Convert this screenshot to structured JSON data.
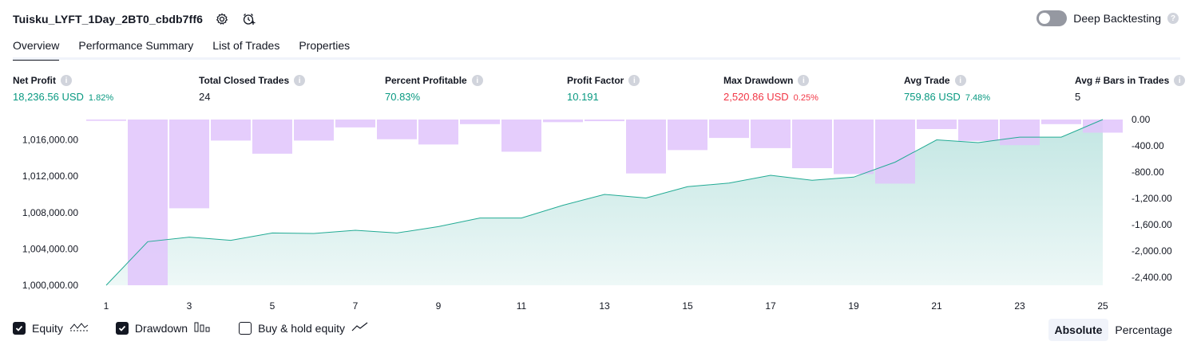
{
  "header": {
    "title": "Tuisku_LYFT_1Day_2BT0_cbdb7ff6",
    "deep_backtesting_label": "Deep Backtesting",
    "help_glyph": "?"
  },
  "tabs": [
    {
      "label": "Overview",
      "active": true
    },
    {
      "label": "Performance Summary",
      "active": false
    },
    {
      "label": "List of Trades",
      "active": false
    },
    {
      "label": "Properties",
      "active": false
    }
  ],
  "metrics": {
    "info_glyph": "i",
    "net_profit": {
      "label": "Net Profit",
      "value": "18,236.56 USD",
      "pct": "1.82%"
    },
    "total_closed_trades": {
      "label": "Total Closed Trades",
      "value": "24"
    },
    "percent_profitable": {
      "label": "Percent Profitable",
      "value": "70.83%"
    },
    "profit_factor": {
      "label": "Profit Factor",
      "value": "10.191"
    },
    "max_drawdown": {
      "label": "Max Drawdown",
      "value": "2,520.86 USD",
      "pct": "0.25%"
    },
    "avg_trade": {
      "label": "Avg Trade",
      "value": "759.86 USD",
      "pct": "7.48%"
    },
    "avg_bars": {
      "label": "Avg # Bars in Trades",
      "value": "5"
    }
  },
  "colors": {
    "equity_line": "#22ab94",
    "equity_fill": "#26a69a",
    "drawdown_bar": "#e1c4fb",
    "profit": "#089981",
    "loss": "#f23645"
  },
  "chart_data": {
    "type": "area",
    "x": [
      1,
      2,
      3,
      4,
      5,
      6,
      7,
      8,
      9,
      10,
      11,
      12,
      13,
      14,
      15,
      16,
      17,
      18,
      19,
      20,
      21,
      22,
      23,
      24,
      25
    ],
    "x_tick_labels": [
      "1",
      "3",
      "5",
      "7",
      "9",
      "11",
      "13",
      "15",
      "17",
      "19",
      "21",
      "23",
      "25"
    ],
    "left_axis": {
      "ticks": [
        1000000,
        1004000,
        1008000,
        1012000,
        1016000
      ],
      "tick_labels": [
        "1,000,000.00",
        "1,004,000.00",
        "1,008,000.00",
        "1,012,000.00",
        "1,016,000.00"
      ],
      "range": [
        1000000,
        1018240
      ]
    },
    "right_axis": {
      "ticks": [
        0,
        -400,
        -800,
        -1200,
        -1600,
        -2000,
        -2400
      ],
      "tick_labels": [
        "0.00",
        "-400.00",
        "-800.00",
        "-1,200.00",
        "-1,600.00",
        "-2,000.00",
        "-2,400.00"
      ],
      "range": [
        -2520.86,
        0
      ]
    },
    "series": [
      {
        "name": "Equity",
        "axis": "left",
        "values": [
          1000000,
          1004800,
          1005300,
          1004950,
          1005750,
          1005700,
          1006050,
          1005750,
          1006450,
          1007400,
          1007400,
          1008800,
          1010000,
          1009600,
          1010850,
          1011250,
          1012100,
          1011550,
          1011900,
          1013550,
          1016000,
          1015700,
          1016300,
          1016300,
          1018236.56
        ]
      },
      {
        "name": "Drawdown",
        "axis": "right",
        "values": [
          -20,
          -2520.86,
          -1350,
          -320,
          -520,
          -320,
          -120,
          -300,
          -380,
          -70,
          -490,
          -40,
          -25,
          -820,
          -465,
          -280,
          -435,
          -740,
          -830,
          -975,
          -145,
          -325,
          -390,
          -70,
          -200
        ]
      }
    ]
  },
  "legend": {
    "equity": {
      "label": "Equity",
      "checked": true
    },
    "drawdown": {
      "label": "Drawdown",
      "checked": true
    },
    "buy_hold": {
      "label": "Buy & hold equity",
      "checked": false
    }
  },
  "view_toggle": {
    "absolute": "Absolute",
    "percentage": "Percentage",
    "selected": "Absolute"
  }
}
